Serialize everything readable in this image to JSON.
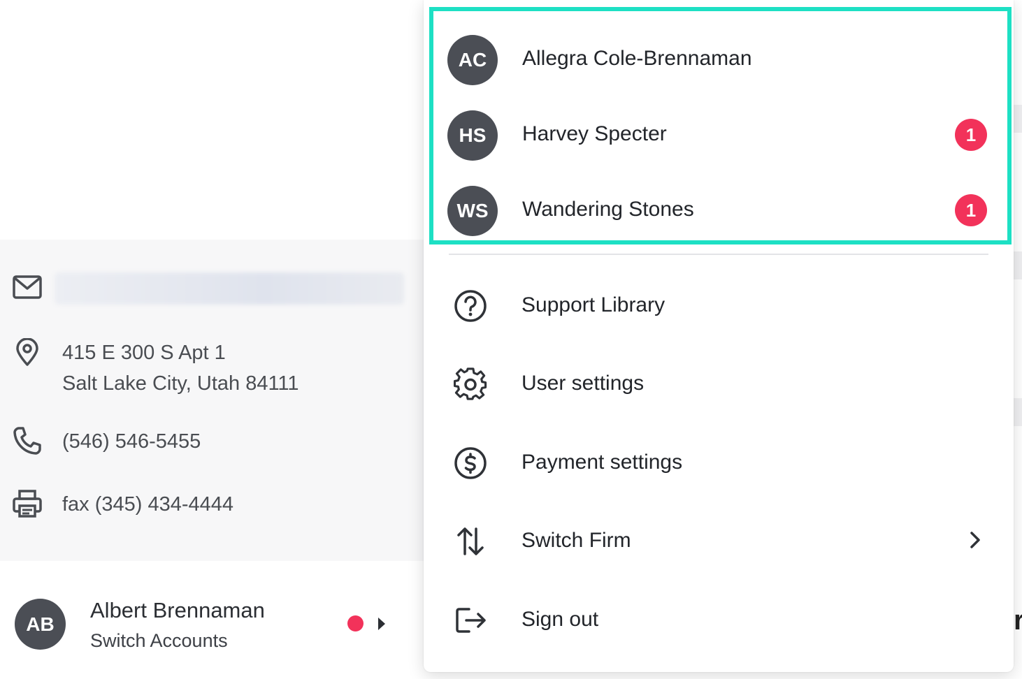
{
  "contact": {
    "email_icon": "mail-icon",
    "address_icon": "map-pin-icon",
    "address_line1": "415 E 300 S Apt 1",
    "address_line2": "Salt Lake City, Utah 84111",
    "phone_icon": "phone-icon",
    "phone": "(546) 546-5455",
    "fax_icon": "printer-icon",
    "fax": "fax (345) 434-4444"
  },
  "account": {
    "initials": "AB",
    "name": "Albert Brennaman",
    "subtitle": "Switch Accounts"
  },
  "dropdown": {
    "accounts": [
      {
        "initials": "AC",
        "name": "Allegra Cole-Brennaman",
        "badge": ""
      },
      {
        "initials": "HS",
        "name": "Harvey Specter",
        "badge": "1"
      },
      {
        "initials": "WS",
        "name": "Wandering Stones",
        "badge": "1"
      }
    ],
    "items": [
      {
        "label": "Support Library",
        "icon": "help-circle-icon"
      },
      {
        "label": "User settings",
        "icon": "gear-icon"
      },
      {
        "label": "Payment settings",
        "icon": "dollar-circle-icon"
      },
      {
        "label": "Switch Firm",
        "icon": "swap-vertical-icon"
      },
      {
        "label": "Sign out",
        "icon": "sign-out-icon"
      }
    ]
  },
  "colors": {
    "highlight": "#1de0c4",
    "badge": "#f2325a",
    "avatar": "#4b4e55"
  }
}
